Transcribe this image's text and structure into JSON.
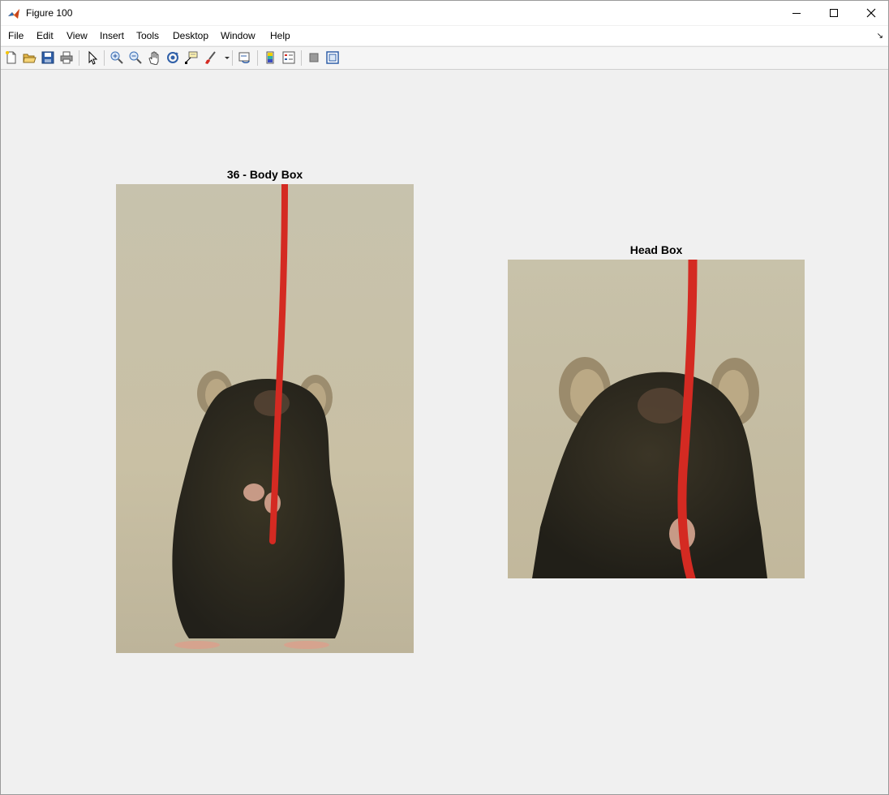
{
  "window": {
    "title": "Figure 100"
  },
  "menu": [
    {
      "label": "File"
    },
    {
      "label": "Edit"
    },
    {
      "label": "View"
    },
    {
      "label": "Insert"
    },
    {
      "label": "Tools"
    },
    {
      "label": "Desktop"
    },
    {
      "label": "Window"
    },
    {
      "label": "Help"
    }
  ],
  "toolbar": {
    "buttons": [
      "new-figure-icon",
      "open-file-icon",
      "save-icon",
      "print-icon",
      "edit-plot-icon",
      "zoom-in-icon",
      "zoom-out-icon",
      "pan-icon",
      "rotate-3d-icon",
      "data-cursor-icon",
      "brush-icon",
      "link-plot-icon",
      "colorbar-icon",
      "legend-icon",
      "hide-plot-tools-icon",
      "show-plot-tools-icon"
    ]
  },
  "axes": [
    {
      "title": "36 - Body Box"
    },
    {
      "title": "Head Box"
    }
  ],
  "colors": {
    "accent_red": "#d42a22",
    "background": "#f0f0f0",
    "photo_bg": "#c9c0a6"
  }
}
